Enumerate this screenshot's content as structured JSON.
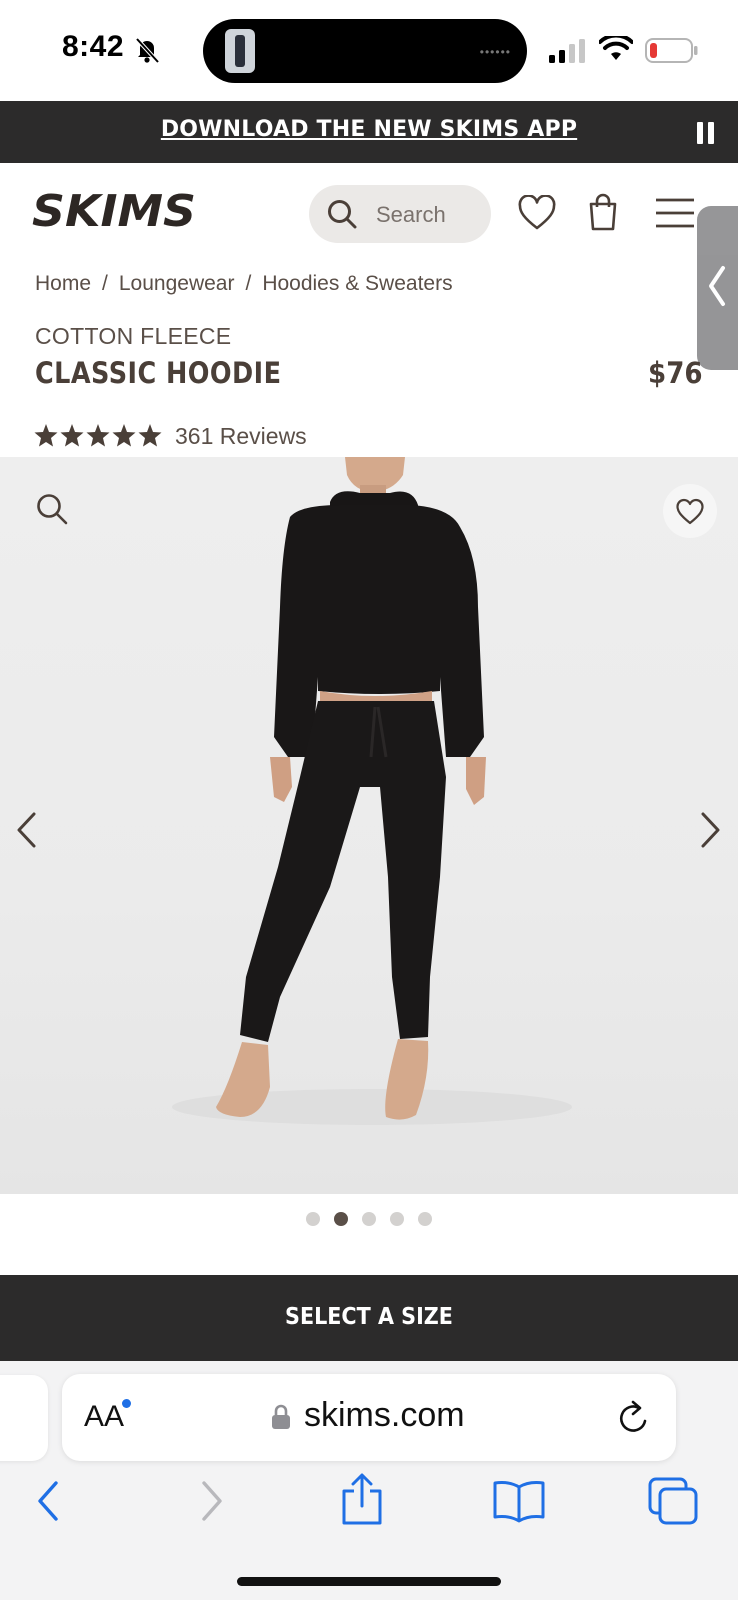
{
  "status_bar": {
    "time": "8:42",
    "icons": [
      "bell-slash-icon",
      "signal-icon",
      "wifi-icon",
      "battery-low-icon"
    ]
  },
  "banner": {
    "text": "DOWNLOAD THE NEW SKIMS APP"
  },
  "header": {
    "logo": "SKIMS",
    "search_placeholder": "Search"
  },
  "breadcrumb": [
    "Home",
    "Loungewear",
    "Hoodies & Sweaters"
  ],
  "breadcrumb_separator": "/",
  "product": {
    "subtitle": "COTTON FLEECE",
    "title": "CLASSIC HOODIE",
    "price": "$76",
    "rating": 5,
    "reviews": "361 Reviews",
    "image_count": 5,
    "active_image": 2
  },
  "cta": {
    "label": "SELECT A SIZE"
  },
  "browser": {
    "aa_label": "AA",
    "url": "skims.com"
  },
  "colors": {
    "brand_text": "#4a3f38",
    "dark_bar": "#2c2b2b",
    "ios_blue": "#1f6fe5"
  }
}
